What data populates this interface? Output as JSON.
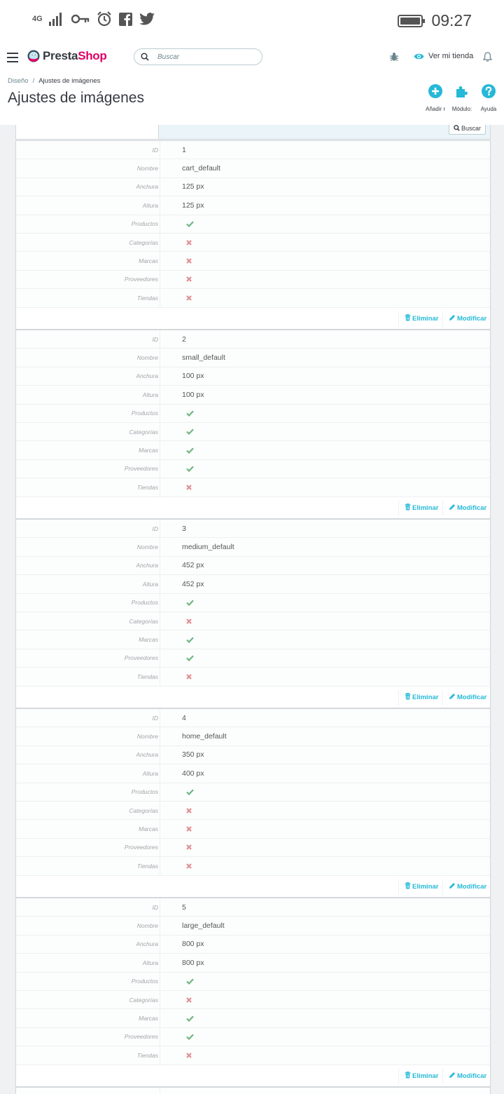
{
  "status_bar": {
    "network": "4G",
    "time": "09:27"
  },
  "header": {
    "logo_prefix": "Presta",
    "logo_suffix": "Shop",
    "search_placeholder": "Buscar",
    "view_shop": "Ver mi tienda"
  },
  "page": {
    "breadcrumb_parent": "Diseño",
    "breadcrumb_current": "Ajustes de imágenes",
    "title": "Ajustes de imágenes",
    "toolbar": [
      {
        "label": "Añadir r",
        "icon": "plus-circle-icon"
      },
      {
        "label": "Módulo:",
        "icon": "puzzle-icon"
      },
      {
        "label": "Ayuda",
        "icon": "help-circle-icon"
      }
    ]
  },
  "filter": {
    "search_label": "Buscar"
  },
  "labels": {
    "id": "ID",
    "name": "Nombre",
    "width": "Anchura",
    "height": "Altura",
    "products": "Productos",
    "categories": "Categorías",
    "brands": "Marcas",
    "suppliers": "Proveedores",
    "stores": "Tiendas"
  },
  "actions": {
    "delete": "Eliminar",
    "edit": "Modificar"
  },
  "colors": {
    "check": "#70b580",
    "cross": "#e08f95",
    "accent": "#25b9d7"
  },
  "image_types": [
    {
      "id": "1",
      "name": "cart_default",
      "width": "125 px",
      "height": "125 px",
      "products": true,
      "categories": false,
      "brands": false,
      "suppliers": false,
      "stores": false
    },
    {
      "id": "2",
      "name": "small_default",
      "width": "100 px",
      "height": "100 px",
      "products": true,
      "categories": true,
      "brands": true,
      "suppliers": true,
      "stores": false
    },
    {
      "id": "3",
      "name": "medium_default",
      "width": "452 px",
      "height": "452 px",
      "products": true,
      "categories": false,
      "brands": true,
      "suppliers": true,
      "stores": false
    },
    {
      "id": "4",
      "name": "home_default",
      "width": "350 px",
      "height": "400 px",
      "products": true,
      "categories": false,
      "brands": false,
      "suppliers": false,
      "stores": false
    },
    {
      "id": "5",
      "name": "large_default",
      "width": "800 px",
      "height": "800 px",
      "products": true,
      "categories": false,
      "brands": true,
      "suppliers": true,
      "stores": false
    }
  ]
}
